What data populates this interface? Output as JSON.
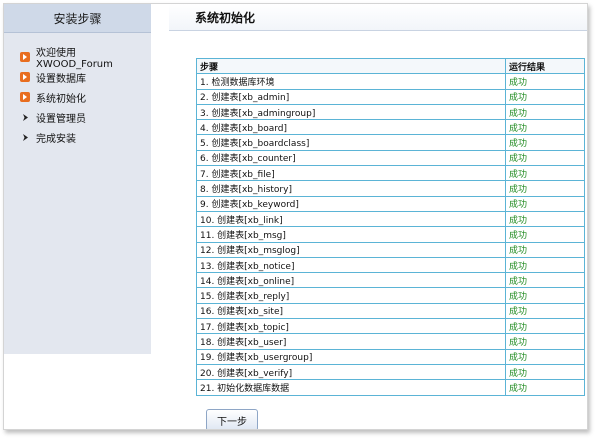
{
  "sidebar": {
    "title": "安装步骤",
    "steps": [
      {
        "label": "欢迎使用XWOOD_Forum",
        "state": "done"
      },
      {
        "label": "设置数据库",
        "state": "done"
      },
      {
        "label": "系统初始化",
        "state": "done"
      },
      {
        "label": "设置管理员",
        "state": "todo"
      },
      {
        "label": "完成安装",
        "state": "todo"
      }
    ]
  },
  "main": {
    "title": "系统初始化",
    "table": {
      "headers": [
        "步骤",
        "运行结果"
      ],
      "rows": [
        [
          "1. 检测数据库环境",
          "成功"
        ],
        [
          "2. 创建表[xb_admin]",
          "成功"
        ],
        [
          "3. 创建表[xb_admingroup]",
          "成功"
        ],
        [
          "4. 创建表[xb_board]",
          "成功"
        ],
        [
          "5. 创建表[xb_boardclass]",
          "成功"
        ],
        [
          "6. 创建表[xb_counter]",
          "成功"
        ],
        [
          "7. 创建表[xb_file]",
          "成功"
        ],
        [
          "8. 创建表[xb_history]",
          "成功"
        ],
        [
          "9. 创建表[xb_keyword]",
          "成功"
        ],
        [
          "10. 创建表[xb_link]",
          "成功"
        ],
        [
          "11. 创建表[xb_msg]",
          "成功"
        ],
        [
          "12. 创建表[xb_msglog]",
          "成功"
        ],
        [
          "13. 创建表[xb_notice]",
          "成功"
        ],
        [
          "14. 创建表[xb_online]",
          "成功"
        ],
        [
          "15. 创建表[xb_reply]",
          "成功"
        ],
        [
          "16. 创建表[xb_site]",
          "成功"
        ],
        [
          "17. 创建表[xb_topic]",
          "成功"
        ],
        [
          "18. 创建表[xb_user]",
          "成功"
        ],
        [
          "19. 创建表[xb_usergroup]",
          "成功"
        ],
        [
          "20. 创建表[xb_verify]",
          "成功"
        ],
        [
          "21. 初始化数据库数据",
          "成功"
        ]
      ]
    },
    "next_label": "下一步"
  },
  "colors": {
    "accent_orange": "#e86d1f",
    "success_green": "#1e8a1e",
    "table_border": "#5bb4d6"
  }
}
